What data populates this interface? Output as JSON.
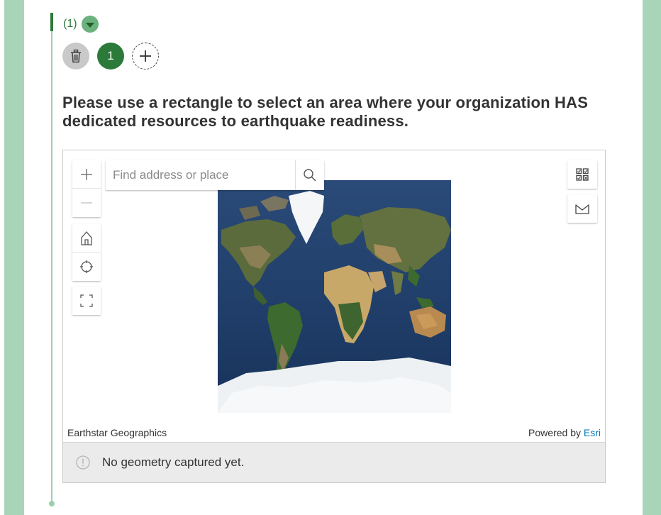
{
  "repeat": {
    "count_label": "(1)",
    "record_number": "1"
  },
  "question": {
    "text": "Please use a rectangle to select an area where your organization HAS dedicated resources to earthquake readiness."
  },
  "map": {
    "search_placeholder": "Find address or place",
    "attribution_left": "Earthstar Geographics",
    "attribution_powered": "Powered by ",
    "attribution_esri": "Esri",
    "basemap": "World Imagery"
  },
  "status": {
    "message": "No geometry captured yet."
  },
  "icons": {
    "zoom_in": "plus-icon",
    "zoom_out": "minus-icon",
    "home": "home-icon",
    "locate": "crosshair-icon",
    "fullscreen": "fullscreen-icon",
    "search": "search-icon",
    "select": "select-grid-icon",
    "basemap": "map-icon",
    "delete": "trash-icon",
    "add": "plus-icon",
    "info": "info-icon"
  },
  "colors": {
    "accent": "#2b7a3a",
    "stripe": "#a8d5b7",
    "link": "#0079c1"
  }
}
